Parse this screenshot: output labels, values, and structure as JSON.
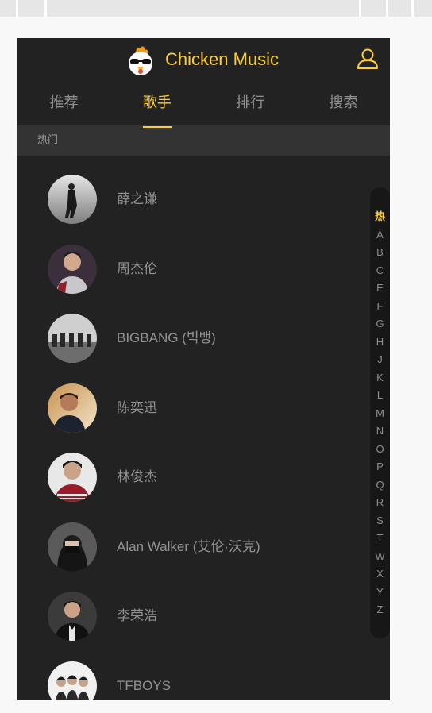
{
  "header": {
    "title": "Chicken Music",
    "logo_icon": "chicken-logo-icon",
    "user_icon": "user-icon"
  },
  "tabs": [
    {
      "label": "推荐",
      "active": false
    },
    {
      "label": "歌手",
      "active": true
    },
    {
      "label": "排行",
      "active": false
    },
    {
      "label": "搜索",
      "active": false
    }
  ],
  "group": {
    "title": "热门"
  },
  "singers": [
    {
      "name": "薛之谦"
    },
    {
      "name": "周杰伦"
    },
    {
      "name": "BIGBANG (빅뱅)"
    },
    {
      "name": "陈奕迅"
    },
    {
      "name": "林俊杰"
    },
    {
      "name": "Alan Walker (艾伦·沃克)"
    },
    {
      "name": "李荣浩"
    },
    {
      "name": "TFBOYS"
    }
  ],
  "shortcut": {
    "items": [
      "热",
      "A",
      "B",
      "C",
      "E",
      "F",
      "G",
      "H",
      "J",
      "K",
      "L",
      "M",
      "N",
      "O",
      "P",
      "Q",
      "R",
      "S",
      "T",
      "W",
      "X",
      "Y",
      "Z"
    ],
    "current": "热"
  },
  "colors": {
    "accent": "#ffcd32",
    "background": "#222222",
    "group_bg": "#333333"
  }
}
